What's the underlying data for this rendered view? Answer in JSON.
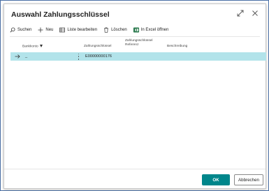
{
  "dialog": {
    "title": "Auswahl Zahlungsschlüssel"
  },
  "toolbar": {
    "search_label": "Suchen",
    "new_label": "Neu",
    "edit_list_label": "Liste bearbeiten",
    "delete_label": "Löschen",
    "excel_label": "In Excel öffnen"
  },
  "table": {
    "columns": {
      "bank_account": "Bankkonto",
      "payment_key": "Zahlungsschlüssel",
      "payment_key_reference_line1": "Zahlungsschlüssel",
      "payment_key_reference_line2": "Referenz",
      "description": "Beschreibung"
    },
    "rows": [
      {
        "bank_account": "_",
        "payment_key": "E00000000176",
        "reference": "",
        "description": ""
      }
    ]
  },
  "footer": {
    "ok_label": "OK",
    "cancel_label": "Abbrechen"
  },
  "colors": {
    "accent": "#00868b",
    "selected_row": "#b2e3ea",
    "excel": "#217346"
  },
  "icons": [
    "expand-icon",
    "close-icon",
    "search-icon",
    "plus-icon",
    "list-edit-icon",
    "delete-icon",
    "excel-icon",
    "row-arrow-icon",
    "filter-icon",
    "row-menu-icon"
  ]
}
